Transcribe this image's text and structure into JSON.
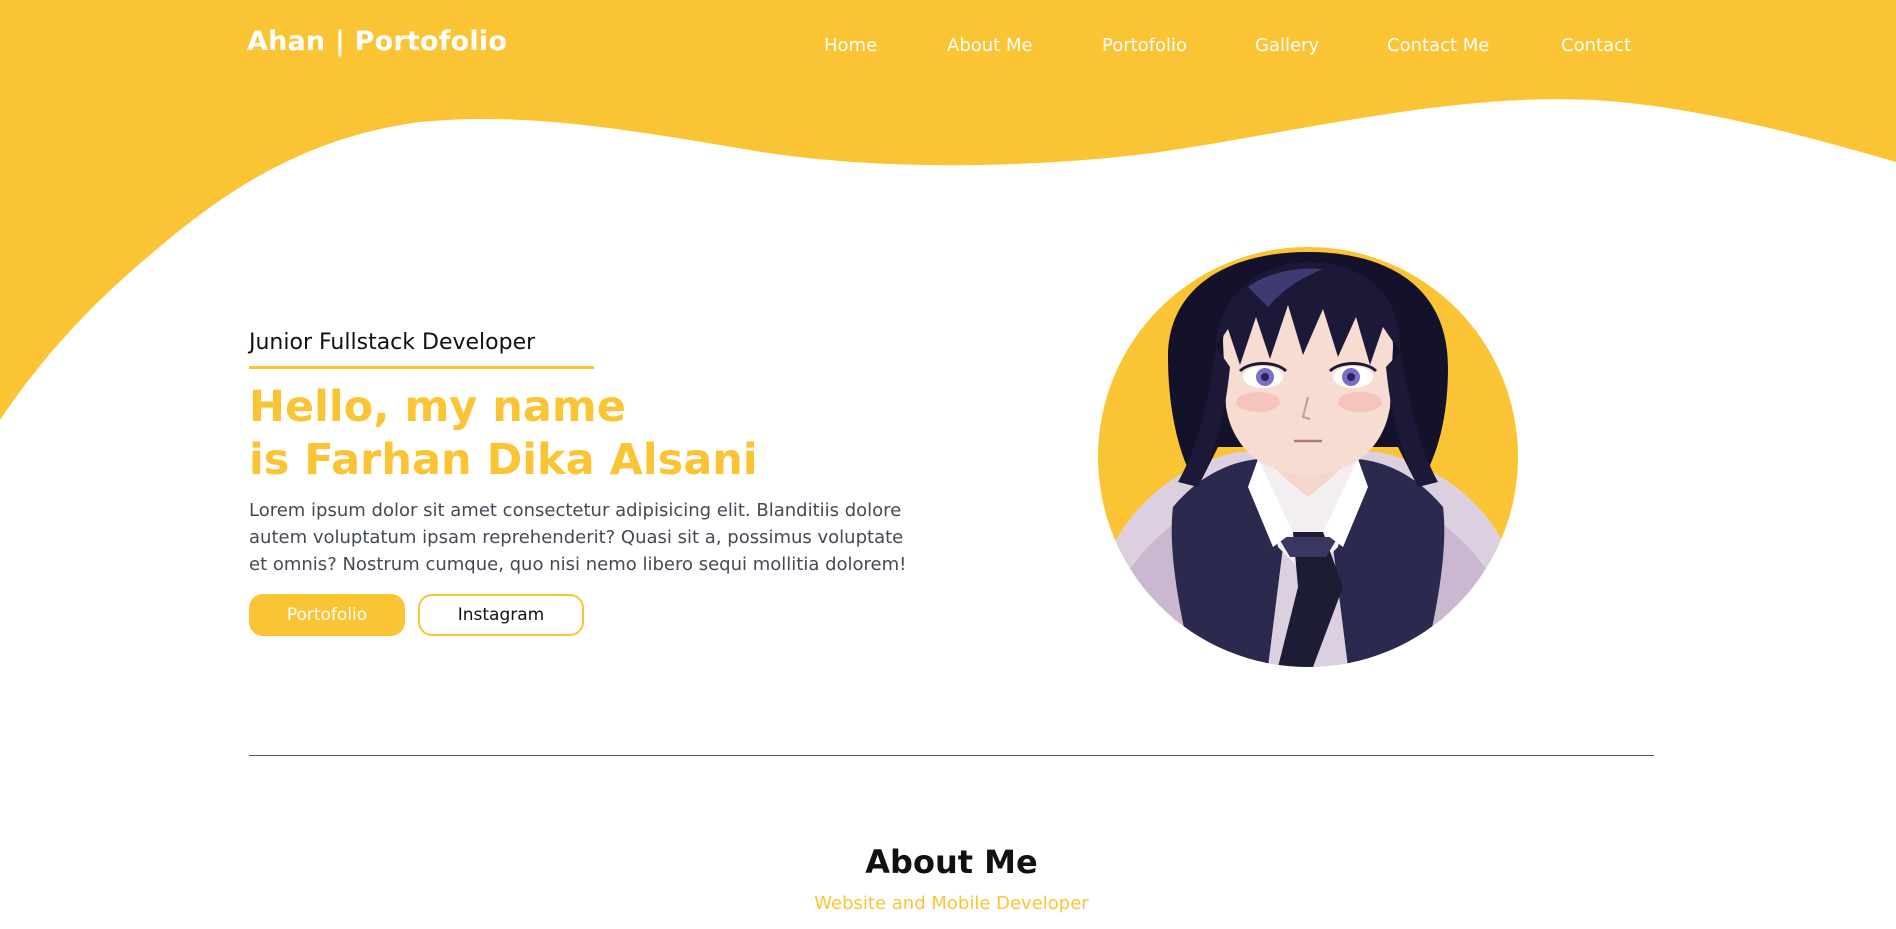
{
  "colors": {
    "accent": "#fbc434",
    "text_dark": "#111111",
    "text_body": "#444a55",
    "nav_text": "#ffffff"
  },
  "navbar": {
    "brand": "Ahan | Portofolio",
    "links": [
      {
        "label": "Home"
      },
      {
        "label": "About Me"
      },
      {
        "label": "Portofolio"
      },
      {
        "label": "Gallery"
      },
      {
        "label": "Contact Me"
      },
      {
        "label": "Contact"
      }
    ]
  },
  "hero": {
    "role": "Junior Fullstack Developer",
    "title_line1": "Hello, my name",
    "title_line2": "is Farhan Dika Alsani",
    "description": "Lorem ipsum dolor sit amet consectetur adipisicing elit. Blanditiis dolore autem voluptatum ipsam reprehenderit? Quasi sit a, possimus voluptate et omnis? Nostrum cumque, quo nisi nemo libero sequi mollitia dolorem!",
    "primary_button": "Portofolio",
    "secondary_button": "Instagram",
    "avatar_icon": "anime-portrait-illustration"
  },
  "about": {
    "heading": "About Me",
    "subheading": "Website and Mobile Developer"
  }
}
